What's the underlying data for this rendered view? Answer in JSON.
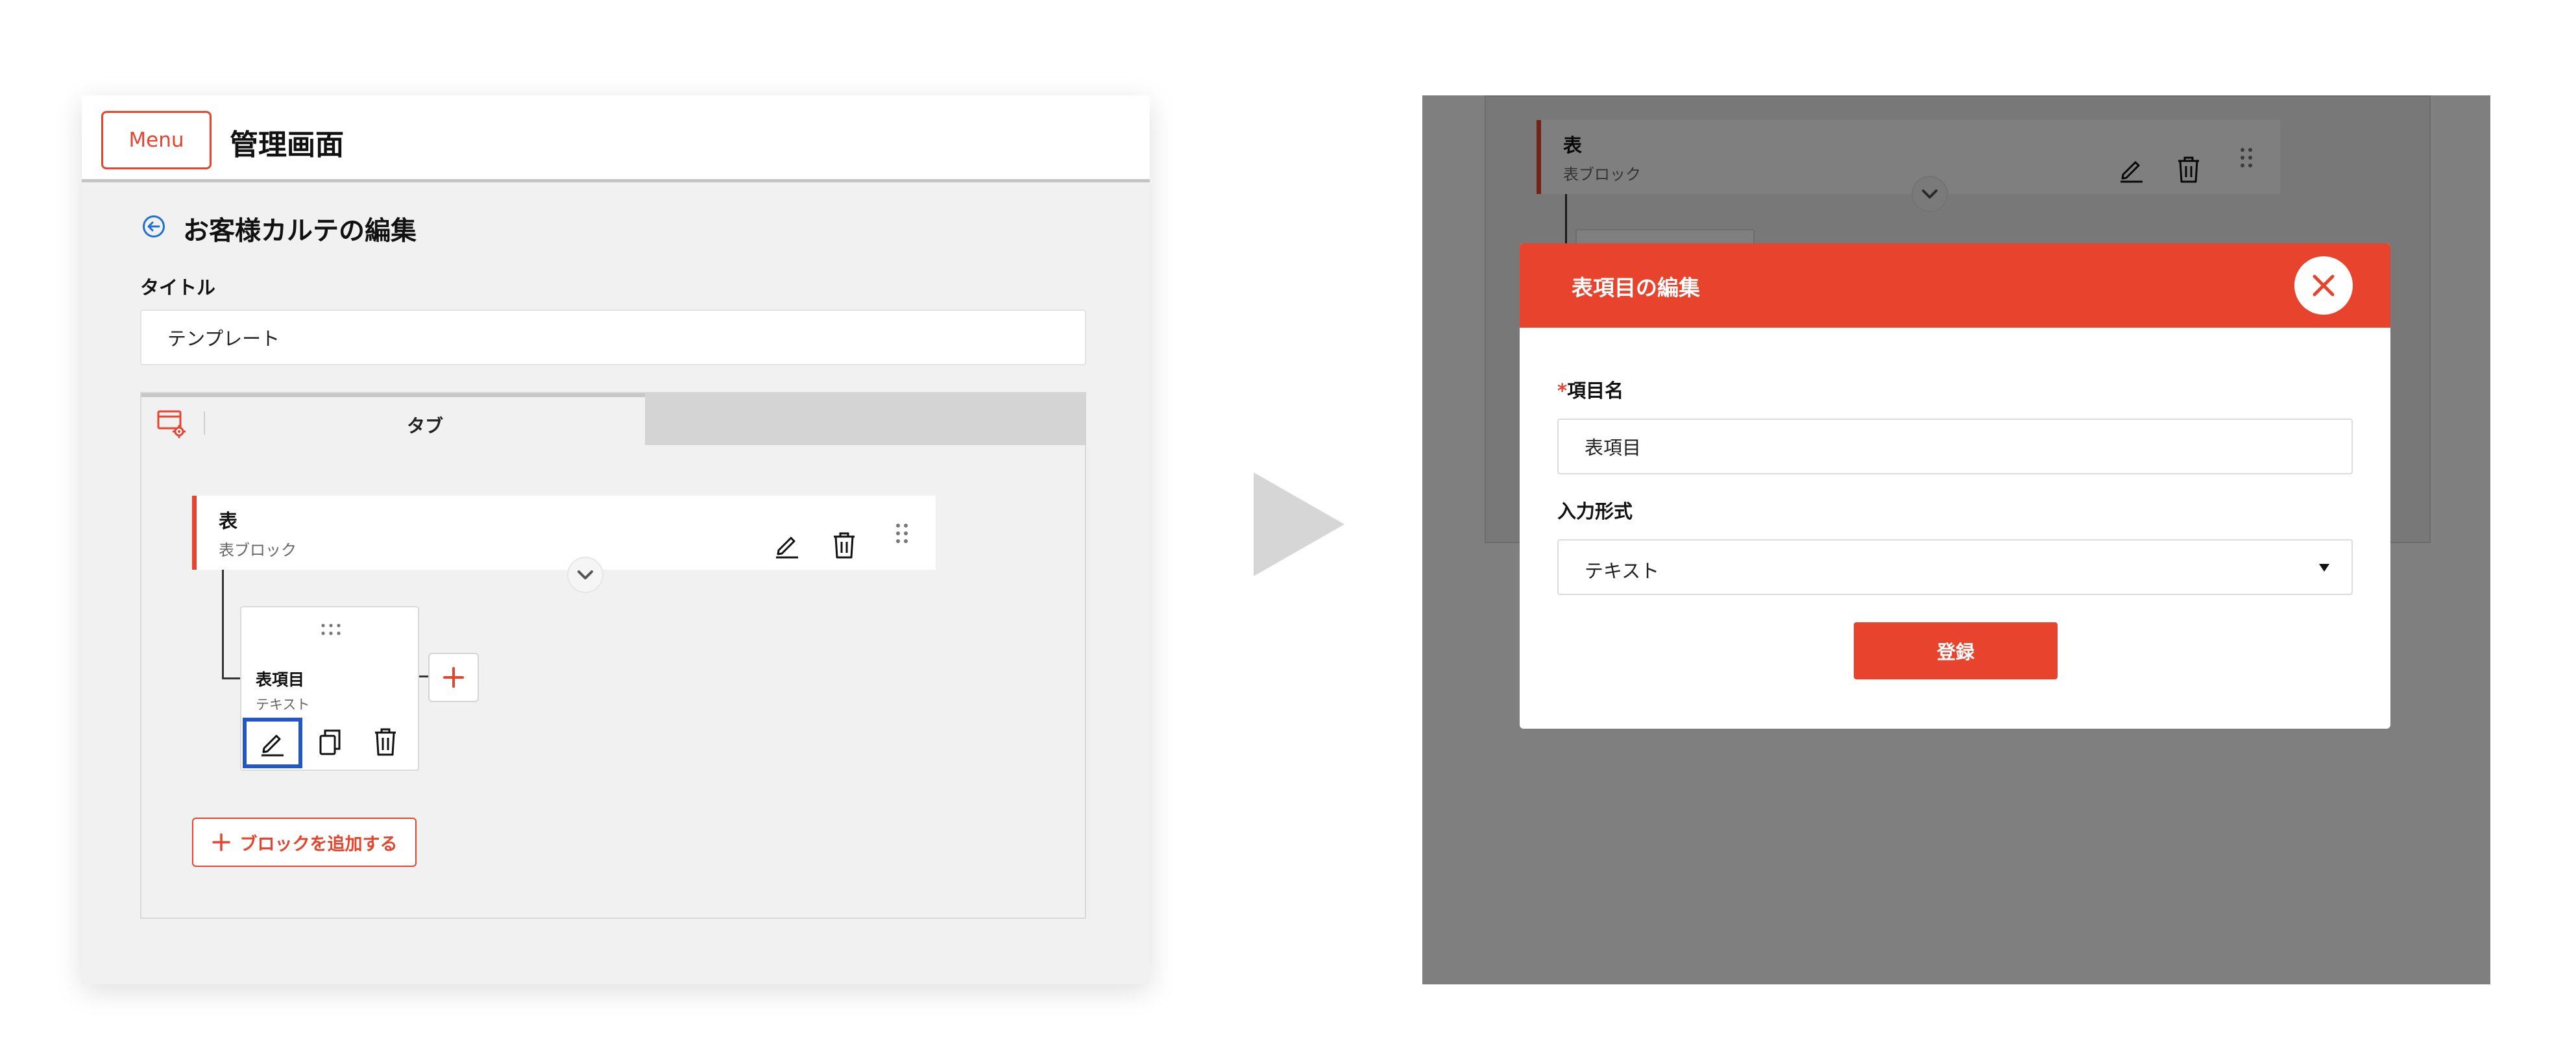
{
  "colors": {
    "accent": "#e8432d",
    "focus_outline": "#2457c5",
    "panel_bg": "#f1f1f1",
    "overlay": "rgba(0,0,0,0.5)"
  },
  "left_screen": {
    "header": {
      "menu_label": "Menu",
      "app_title": "管理画面"
    },
    "page": {
      "back_icon": "circle-arrow-left-icon",
      "title": "お客様カルテの編集"
    },
    "form": {
      "title_label": "タイトル",
      "title_value": "テンプレート"
    },
    "tabs": [
      {
        "label": "タブ",
        "active": true
      }
    ],
    "block": {
      "title": "表",
      "subtitle": "表ブロック",
      "icons": [
        "pencil-icon",
        "trash-icon",
        "drag-handle-icon",
        "chevron-down-icon"
      ]
    },
    "item": {
      "title": "表項目",
      "subtitle": "テキスト",
      "icons": [
        "pencil-icon",
        "copy-icon",
        "trash-icon",
        "drag-handle-icon"
      ]
    },
    "add_block_label": "ブロックを追加する"
  },
  "right_screen": {
    "background_block": {
      "title": "表",
      "subtitle": "表ブロック"
    },
    "modal": {
      "title": "表項目の編集",
      "name_label_required": "*",
      "name_label": "項目名",
      "name_value": "表項目",
      "type_label": "入力形式",
      "type_value": "テキスト",
      "submit_label": "登録"
    }
  }
}
